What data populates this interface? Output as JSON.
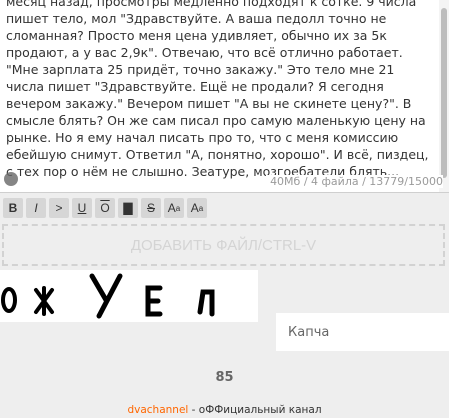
{
  "post": {
    "text": "месяц назад, просмотры медленно подходят к сотке. 9 числа пишет тело, мол \"Здравствуйте. А ваша педолл точно не сломанная? Просто меня цена удивляет, обычно их за 5к продают, а у вас 2,9к\". Отвечаю, что всё отлично работает. \"Мне зарплата 25 придёт, точно закажу.\" Это тело мне 21 числа пишет \"Здравствуйте. Ещё не продали? Я сегодня вечером закажу.\" Вечером пишет \"А вы не скинете цену?\". В смысле блять? Он же сам писал про самую маленькую цену на рынке. Но я ему начал писать про то, что с меня комиссию ебейшую снимут. Ответил \"А, понятно, хорошо\". И всё, пиздец, с тех пор о нём не слышно. Зеатуре, мозгоебатели блять...",
    "status": "40Мб / 4 файла / 13779/15000"
  },
  "toolbar": {
    "bold": "B",
    "italic": "I",
    "quote": ">",
    "underline": "U",
    "overline": "O",
    "spoiler": "▇",
    "strike": "S",
    "sup": "A",
    "sub": "A"
  },
  "upload": {
    "label": "ДОБАВИТЬ ФАЙЛ/CTRL-V"
  },
  "captcha": {
    "image_text": "ОЖУЕЛ",
    "placeholder": "Капча"
  },
  "counter": "85",
  "footer": {
    "link": "dvachannel",
    "text": " - оФФициальный канал"
  },
  "colors": {
    "background": "#eeeeee",
    "footer_link": "#ff6600"
  }
}
